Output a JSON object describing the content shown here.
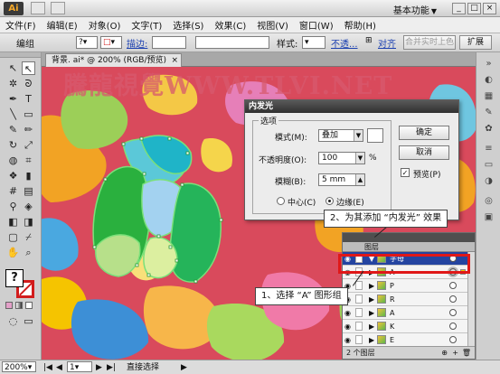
{
  "app": {
    "logo": "Ai",
    "workspace": "基本功能",
    "window_buttons": [
      "_",
      "□",
      "×"
    ]
  },
  "menu": [
    "文件(F)",
    "编辑(E)",
    "对象(O)",
    "文字(T)",
    "选择(S)",
    "效果(C)",
    "视图(V)",
    "窗口(W)",
    "帮助(H)"
  ],
  "control_bar": {
    "selection_label": "编组",
    "stroke_label": "描边:",
    "style_label": "样式:",
    "opacity_link": "不透...",
    "align_link": "对齐",
    "merge_button": "合并实时上色",
    "expand_button": "扩展"
  },
  "document": {
    "tab_label": "背景. ai* @ 200% (RGB/预览)",
    "close_glyph": "×"
  },
  "watermark": "騰龍視覺WWW.TLVI.NET",
  "dialog": {
    "title": "内发光",
    "group_label": "选项",
    "mode_label": "模式(M):",
    "mode_value": "叠加",
    "opacity_label": "不透明度(O):",
    "opacity_value": "100",
    "opacity_unit": "%",
    "blur_label": "模糊(B):",
    "blur_value": "5 mm",
    "center_label": "中心(C)",
    "edge_label": "边缘(E)",
    "ok_button": "确定",
    "cancel_button": "取消",
    "preview_label": "预览(P)",
    "preview_checked": true,
    "color_swatch": "#ffffff"
  },
  "layers_panel": {
    "header": "",
    "tab_label": "图层",
    "parent_layer": "字母",
    "rows": [
      "A",
      "P",
      "R",
      "A",
      "K",
      "E",
      "P",
      "A"
    ],
    "footer": "2 个图层",
    "footer_icons": [
      "⊕",
      "+",
      "🗑"
    ]
  },
  "callouts": {
    "step1": "1、选择 “A” 图形组",
    "step2": "2、为其添加 “内发光” 效果"
  },
  "status_bar": {
    "zoom": "200%",
    "page": "1",
    "tool_status": "直接选择"
  },
  "colors": {
    "canvas_bg": "#d94a5c",
    "highlight": "#e01818",
    "layer_selected": "#2444a0"
  }
}
